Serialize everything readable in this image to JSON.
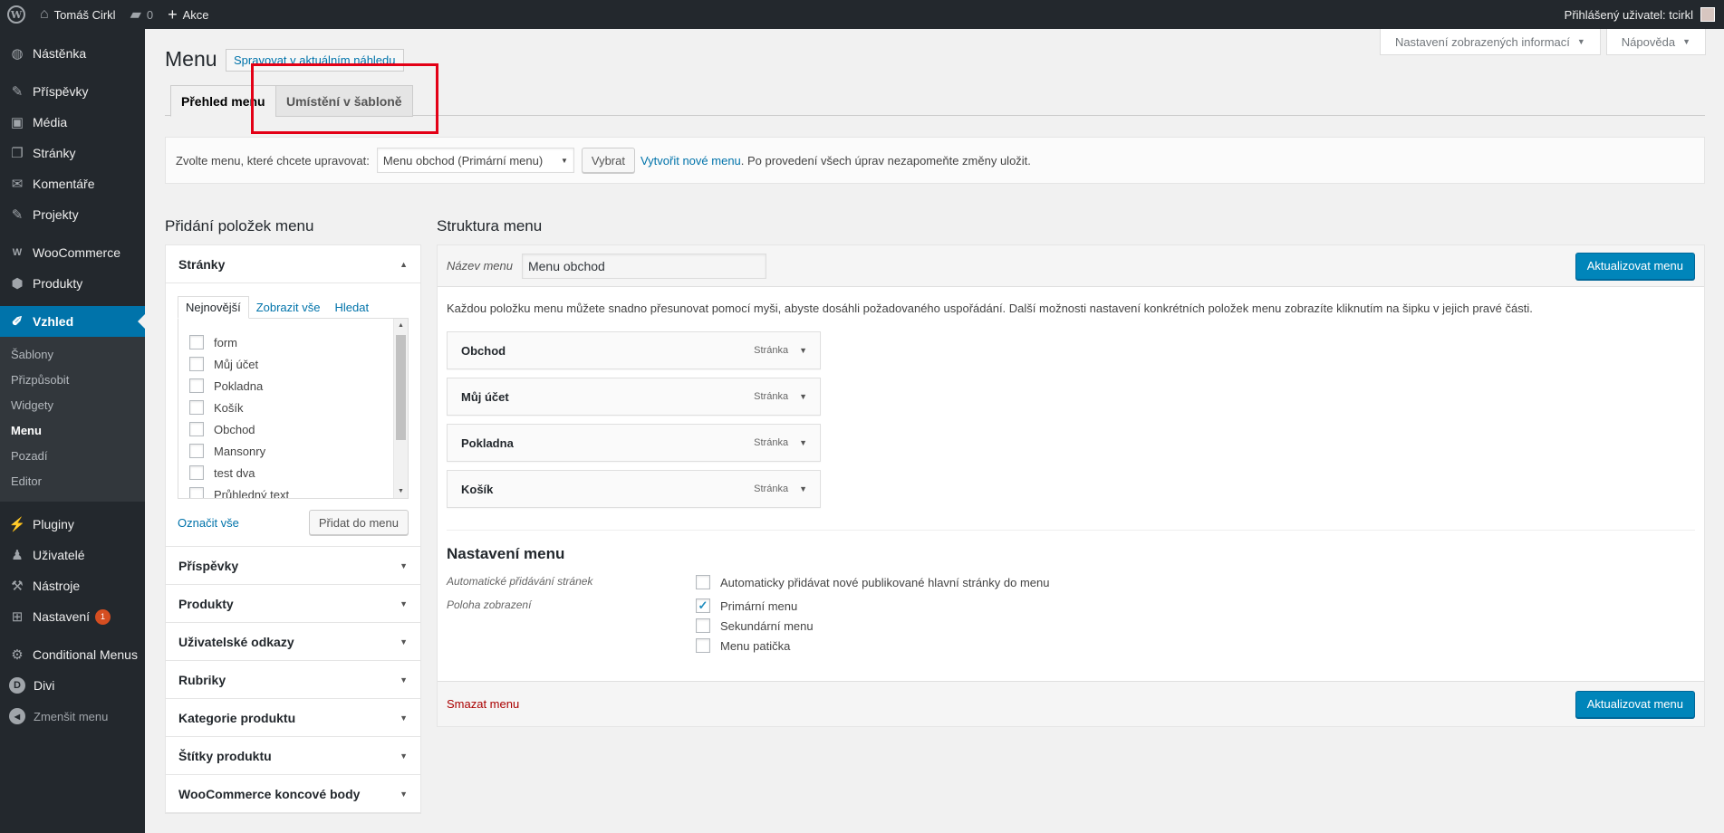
{
  "adminbar": {
    "logo": "W",
    "site_name": "Tomáš Cirkl",
    "comments_count": "0",
    "new_label": "Akce",
    "user_greeting": "Přihlášený uživatel: tcirkl"
  },
  "sidebar": {
    "items": [
      {
        "label": "Nástěnka",
        "icon": "◍"
      },
      {
        "label": "Příspěvky",
        "icon": "✎"
      },
      {
        "label": "Média",
        "icon": "▣"
      },
      {
        "label": "Stránky",
        "icon": "❐"
      },
      {
        "label": "Komentáře",
        "icon": "✉"
      },
      {
        "label": "Projekty",
        "icon": "✎"
      },
      {
        "label": "WooCommerce",
        "icon": "W"
      },
      {
        "label": "Produkty",
        "icon": "⬢"
      },
      {
        "label": "Vzhled",
        "icon": "✐"
      },
      {
        "label": "Pluginy",
        "icon": "⚡"
      },
      {
        "label": "Uživatelé",
        "icon": "♟"
      },
      {
        "label": "Nástroje",
        "icon": "⚒"
      },
      {
        "label": "Nastavení",
        "icon": "⊞",
        "badge": "1"
      },
      {
        "label": "Conditional Menus",
        "icon": "⚙"
      },
      {
        "label": "Divi",
        "icon": "D"
      },
      {
        "label": "Zmenšit menu",
        "icon": "◀"
      }
    ],
    "submenu": [
      "Šablony",
      "Přizpůsobit",
      "Widgety",
      "Menu",
      "Pozadí",
      "Editor"
    ]
  },
  "screen_meta": {
    "options_label": "Nastavení zobrazených informací",
    "help_label": "Nápověda"
  },
  "page": {
    "title": "Menu",
    "title_action": "Spravovat v aktuálním náhledu"
  },
  "tabs": {
    "edit": "Přehled menu",
    "locations": "Umístění v šabloně"
  },
  "manage": {
    "prompt": "Zvolte menu, které chcete upravovat:",
    "selected_menu": "Menu obchod (Primární menu)",
    "select_button": "Vybrat",
    "create_link": "Vytvořit nové menu",
    "note": ". Po provedení všech úprav nezapomeňte změny uložit."
  },
  "add_items": {
    "title": "Přidání položek menu",
    "pages_section": "Stránky",
    "inner_tabs": [
      "Nejnovější",
      "Zobrazit vše",
      "Hledat"
    ],
    "pages": [
      "form",
      "Můj účet",
      "Pokladna",
      "Košík",
      "Obchod",
      "Mansonry",
      "test dva",
      "Průhledný text"
    ],
    "select_all": "Označit vše",
    "add_button": "Přidat do menu",
    "sections": [
      "Příspěvky",
      "Produkty",
      "Uživatelské odkazy",
      "Rubriky",
      "Kategorie produktu",
      "Štítky produktu",
      "WooCommerce koncové body"
    ]
  },
  "structure": {
    "title": "Struktura menu",
    "name_label": "Název menu",
    "name_value": "Menu obchod",
    "save_button": "Aktualizovat menu",
    "instructions": "Každou položku menu můžete snadno přesunovat pomocí myši, abyste dosáhli požadovaného uspořádání. Další možnosti nastavení konkrétních položek menu zobrazíte kliknutím na šipku v jejich pravé části.",
    "items": [
      {
        "title": "Obchod",
        "type": "Stránka"
      },
      {
        "title": "Můj účet",
        "type": "Stránka"
      },
      {
        "title": "Pokladna",
        "type": "Stránka"
      },
      {
        "title": "Košík",
        "type": "Stránka"
      }
    ],
    "settings_title": "Nastavení menu",
    "auto_add_label": "Automatické přidávání stránek",
    "auto_add_option": "Automaticky přidávat nové publikované hlavní stránky do menu",
    "location_label": "Poloha zobrazení",
    "locations": [
      {
        "label": "Primární menu",
        "checked": true
      },
      {
        "label": "Sekundární menu",
        "checked": false
      },
      {
        "label": "Menu patička",
        "checked": false
      }
    ],
    "delete_link": "Smazat menu"
  }
}
